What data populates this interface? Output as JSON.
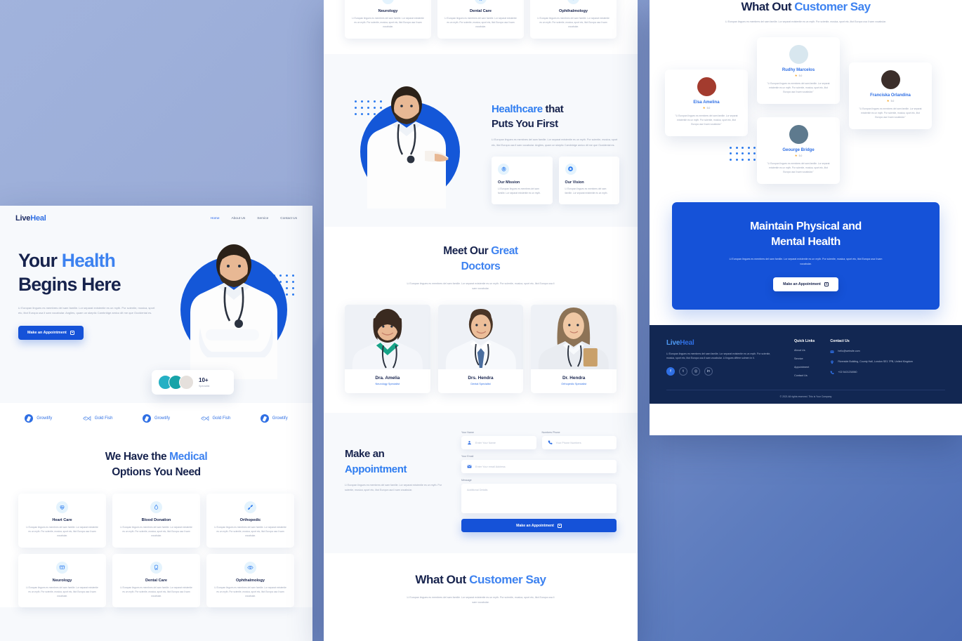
{
  "brand": {
    "name_part1": "Live",
    "name_part2": "Heal"
  },
  "colors": {
    "accent": "#2563eb",
    "primary": "#1552d8",
    "dark": "#17234d",
    "footer_bg": "#122752",
    "page_bg": "#98abd8"
  },
  "nav": {
    "items": [
      "Home",
      "About Us",
      "Service",
      "Contact Us"
    ]
  },
  "hero": {
    "title_line1_a": "Your ",
    "title_line1_b": "Health",
    "title_line2": "Begins Here",
    "paragraph": "Li Europan lingues es membres del sam familie. Lor separat existentie es un myth. Por scientie, musica, sport etc, litot Europa usa li sam vocabular. Anglies, quam un skeptic Cambridge amico dit me que Occidental es.",
    "cta_label": "Make an Appointment",
    "badge_count": "10+",
    "badge_label": "Specialist"
  },
  "brands": [
    {
      "name": "Growtify",
      "icon": "growtify-icon"
    },
    {
      "name": "Gold Fish",
      "icon": "goldfish-icon"
    },
    {
      "name": "Growtify",
      "icon": "growtify-icon"
    },
    {
      "name": "Gold Fish",
      "icon": "goldfish-icon"
    },
    {
      "name": "Growtify",
      "icon": "growtify-icon"
    }
  ],
  "services": {
    "heading_a": "We Have the ",
    "heading_b": "Medical",
    "heading_line2": "Options You Need",
    "body": "Li Europan lingues es membres del sam familie. Lor separat existentie es un myth. Por scientie, musica, sport etc, litot Europa usa li sam vocabular.",
    "cards": [
      {
        "title": "Heart Care",
        "icon": "heart-pulse-icon"
      },
      {
        "title": "Blood Donation",
        "icon": "blood-drop-icon"
      },
      {
        "title": "Orthopedic",
        "icon": "bone-icon"
      },
      {
        "title": "Neurology",
        "icon": "brain-icon"
      },
      {
        "title": "Dental Care",
        "icon": "tooth-icon"
      },
      {
        "title": "Ophthalmology",
        "icon": "eye-icon"
      }
    ]
  },
  "healthcare": {
    "heading_a": "Healthcare",
    "heading_b": " that",
    "heading_line2": "Puts You First",
    "paragraph": "Li Europan lingues es membres del sam familie. Lor separat existentie es un myth. Por scientie, musica, sport etc, litot Europa usa li sam vocabular. Anglies, quam un skeptic Cambridge amico dit me que Occidental es.",
    "cards": [
      {
        "title": "Our Mission",
        "icon": "target-icon",
        "body": "Li Europan lingues es membres del sam familie. Lor separat existentie es un myth."
      },
      {
        "title": "Our Vision",
        "icon": "star-badge-icon",
        "body": "Li Europan lingues es membres del sam familie. Lor separat existentie es un myth."
      }
    ]
  },
  "doctors": {
    "heading_a": "Meet Our ",
    "heading_b": "Great",
    "heading_line2": "Doctors",
    "body": "Li Europan lingues es membres del sam familie. Lor separat existentie es un myth. Por scientie, musica, sport etc, litot Europa usa li sam vocabular.",
    "cards": [
      {
        "name": "Dra. Amelia",
        "specialty": "Neurology Specialist"
      },
      {
        "name": "Drs. Hendra",
        "specialty": "Dental Specialist"
      },
      {
        "name": "Dr. Hendra",
        "specialty": "Orthopedic Specialist"
      }
    ]
  },
  "appointment": {
    "heading_a": "Make an",
    "heading_b": "Appointment",
    "paragraph": "Li Europan lingues es membres del sam familie. Lor separat existentie es un myth. Por scientie, musica, sport etc, litot Europa usa li sam vocabular.",
    "fields": {
      "name_label": "Your Name",
      "name_placeholder": "Enter Your Name",
      "phone_label": "Numbers Phone",
      "phone_placeholder": "Your Phone Numbers",
      "email_label": "Your Email",
      "email_placeholder": "Enter Your email Address",
      "message_label": "Message",
      "message_placeholder": "Additional Details"
    },
    "submit_label": "Make an Appointment"
  },
  "testimonials": {
    "heading_a": "What Out ",
    "heading_b": "Customer Say",
    "body": "Li Europan lingues es membres del sam familie. Lor separat existentie es un myth. Por scientie, musica, sport etc, litot Europa usa li sam vocabular.",
    "cards": [
      {
        "name": "Elsa Amelina",
        "rating": "5.0",
        "quote": "\"Li Europan lingues es membres del sam familie. Lor separat existentie es un myth. Por scientie, musica, sport etc, litot Europa usa li sam vocabular.\""
      },
      {
        "name": "Rudhy Marcelos",
        "rating": "5.0",
        "quote": "\"Li Europan lingues es membres del sam familie. Lor separat existentie es un myth. Por scientie, musica, sport etc, litot Europa usa li sam vocabular.\""
      },
      {
        "name": "Geourge Bridge",
        "rating": "5.0",
        "quote": "\"Li Europan lingues es membres del sam familie. Lor separat existentie es un myth. Por scientie, musica, sport etc, litot Europa usa li sam vocabular.\""
      },
      {
        "name": "Franciska Orlandina",
        "rating": "5.0",
        "quote": "\"Li Europan lingues es membres del sam familie. Lor separat existentie es un myth. Por scientie, musica, sport etc, litot Europa usa li sam vocabular.\""
      }
    ]
  },
  "cta_banner": {
    "title_line1": "Maintain Physical and",
    "title_line2": "Mental Health",
    "paragraph": "Li Europan lingues es membres del sam familie. Lor separat existentie es un myth. Por scientie, musica, sport etc, litot Europa usa li sam vocabular.",
    "button_label": "Make an Appointment"
  },
  "footer": {
    "about": "Li Europan lingues es membres del sam familie. Lor separat existentie es un myth. Por scientie, musica, sport etc, litot Europa usa li sam vocabular. Li lingues differe solmen in li.",
    "social": [
      "facebook-icon",
      "twitter-icon",
      "instagram-icon",
      "linkedin-icon"
    ],
    "quick_links_title": "Quick Links",
    "quick_links": [
      "About Us",
      "Service",
      "Appointment",
      "Contact Us"
    ],
    "contact_title": "Contact Us",
    "email": "hello@website.com",
    "address": "Riverside Building, County Hall, London SE1 7PB, United Kingdom",
    "phone": "+02 5421234560",
    "copyright": "© 2021 All rights reserved. This is Your Company"
  }
}
